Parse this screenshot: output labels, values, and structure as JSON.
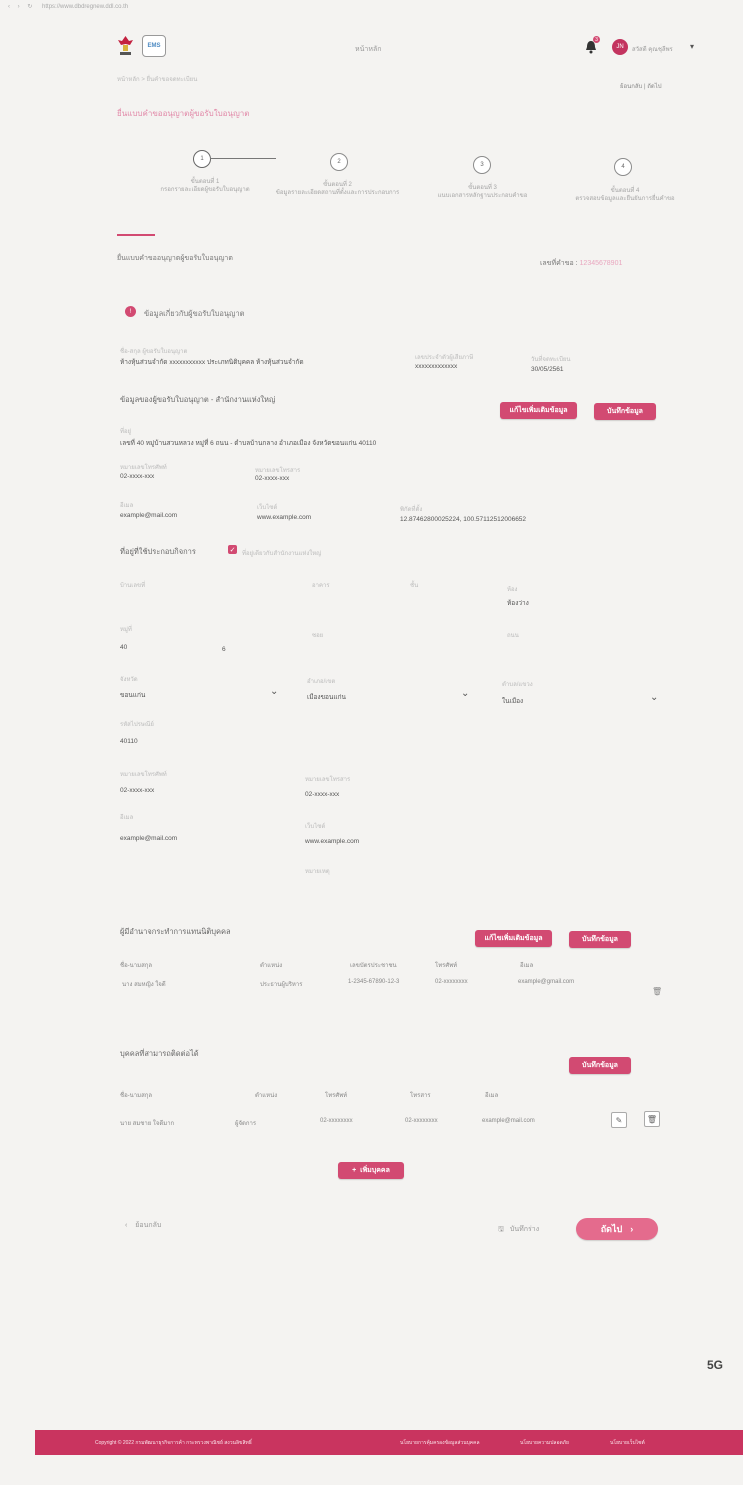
{
  "browser": {
    "url": "https://www.dbdregnew.ddl.co.th"
  },
  "header": {
    "logo_text": "LOGO",
    "ebms_badge": "EMS",
    "nav_home": "หน้าหลัก",
    "notif_count": "3",
    "user_initials": "JN",
    "user_name": "สวัสดี คุณชุลีพร"
  },
  "breadcrumb": {
    "text": "หน้าหลัก > ยื่นคำขอจดทะเบียน",
    "pagination": "ย้อนกลับ  |  ถัดไป"
  },
  "page_title": "ยื่นแบบคำขออนุญาตผู้ขอรับใบอนุญาต",
  "steps": [
    {
      "num": "1",
      "label_top": "ขั้นตอนที่ 1",
      "label": "กรอกรายละเอียดผู้ขอรับใบอนุญาต"
    },
    {
      "num": "2",
      "label_top": "ขั้นตอนที่ 2",
      "label": "ข้อมูลรายละเอียดสถานที่ตั้งและการประกอบการ"
    },
    {
      "num": "3",
      "label_top": "ขั้นตอนที่ 3",
      "label": "แนบเอกสารหลักฐานประกอบคำขอ"
    },
    {
      "num": "4",
      "label_top": "ขั้นตอนที่ 4",
      "label": "ตรวจสอบข้อมูลและยืนยันการยื่นคำขอ"
    }
  ],
  "form_section": {
    "title": "ยื่นแบบคำขออนุญาตผู้ขอรับใบอนุญาต",
    "ref_label": "เลขที่คำขอ :",
    "ref_value": "12345678901"
  },
  "applicant": {
    "section_title": "ข้อมูลเกี่ยวกับผู้ขอรับใบอนุญาต",
    "label_name": "ชื่อ-สกุล ผู้ขอรับใบอนุญาต",
    "name_value": "ห้างหุ้นส่วนจำกัด xxxxxxxxxxx ประเภทนิติบุคคล ห้างหุ้นส่วนจำกัด",
    "label_id": "เลขประจำตัวผู้เสียภาษี",
    "id_value": "xxxxxxxxxxxxx",
    "label_date": "วันที่จดทะเบียน",
    "date_value": "30/05/2561"
  },
  "hq": {
    "title": "ข้อมูลของผู้ขอรับใบอนุญาต - สำนักงานแห่งใหญ่",
    "btn_edit": "แก้ไขเพิ่มเติมข้อมูล",
    "btn_save": "บันทึกข้อมูล",
    "label_address": "ที่อยู่",
    "address": "เลขที่ 40 หมู่บ้านสวนหลวง หมู่ที่ 6 ถนน - ตำบลบ้านกลาง อำเภอเมือง จังหวัดขอนแก่น 40110",
    "label_phone": "หมายเลขโทรศัพท์",
    "phone": "02-xxxx-xxx",
    "label_fax": "หมายเลขโทรสาร",
    "fax": "02-xxxx-xxx",
    "label_email": "อีเมล",
    "email": "example@mail.com",
    "label_web": "เว็บไซต์",
    "web": "www.example.com",
    "label_coord": "พิกัดที่ตั้ง",
    "coord": "12.87462800025224, 100.57112512006652"
  },
  "branch": {
    "title": "ที่อยู่ที่ใช้ประกอบกิจการ",
    "same_label": "ที่อยู่เดียวกับสำนักงานแห่งใหญ่",
    "label_house": "บ้านเลขที่",
    "label_building": "อาคาร",
    "label_floor": "ชั้น",
    "label_room": "ห้อง",
    "room_value": "ห้องว่าง",
    "label_moo": "หมู่ที่",
    "moo_value": "40",
    "moo_sep": "6",
    "label_soi": "ซอย",
    "label_road": "ถนน",
    "label_province": "จังหวัด",
    "province": "ขอนแก่น",
    "label_district": "อำเภอ/เขต",
    "district": "เมืองขอนแก่น",
    "label_subdistrict": "ตำบล/แขวง",
    "subdistrict": "ในเมือง",
    "label_zip": "รหัสไปรษณีย์",
    "zip": "40110",
    "label_phone": "หมายเลขโทรศัพท์",
    "phone": "02-xxxx-xxx",
    "label_fax": "หมายเลขโทรสาร",
    "fax": "02-xxxx-xxx",
    "label_email": "อีเมล",
    "email": "example@mail.com",
    "label_web": "เว็บไซต์",
    "web": "www.example.com",
    "label_note": "หมายเหตุ"
  },
  "authorized": {
    "title": "ผู้มีอำนาจกระทำการแทนนิติบุคคล",
    "btn_edit": "แก้ไขเพิ่มเติมข้อมูล",
    "btn_save": "บันทึกข้อมูล",
    "headers": [
      "ชื่อ-นามสกุล",
      "ตำแหน่ง",
      "เลขบัตรประชาชน",
      "โทรศัพท์",
      "อีเมล"
    ],
    "row": [
      "นาง สมหญิง ใจดี",
      "ประธานผู้บริหาร",
      "1-2345-67890-12-3",
      "02-xxxxxxxx",
      "example@gmail.com"
    ]
  },
  "contact": {
    "title": "บุคคลที่สามารถติดต่อได้",
    "btn_save": "บันทึกข้อมูล",
    "headers": [
      "ชื่อ-นามสกุล",
      "ตำแหน่ง",
      "โทรศัพท์",
      "โทรสาร",
      "อีเมล"
    ],
    "row": [
      "นาย สมชาย ใจดีมาก",
      "ผู้จัดการ",
      "02-xxxxxxxx",
      "02-xxxxxxxx",
      "example@mail.com"
    ],
    "add_button": "เพิ่มบุคคล"
  },
  "bottom_nav": {
    "back": "ย้อนกลับ",
    "save_draft": "บันทึกร่าง",
    "next": "ถัดไป"
  },
  "footer": {
    "copyright": "Copyright © 2022 กรมพัฒนาธุรกิจการค้า กระทรวงพาณิชย์ สงวนลิขสิทธิ์",
    "link1": "นโยบายการคุ้มครองข้อมูลส่วนบุคคล",
    "link2": "นโยบายความปลอดภัย",
    "link3": "นโยบายเว็บไซต์"
  },
  "colors": {
    "accent": "#d24a72",
    "footer": "#c9345f",
    "background": "#f4f3f1"
  }
}
